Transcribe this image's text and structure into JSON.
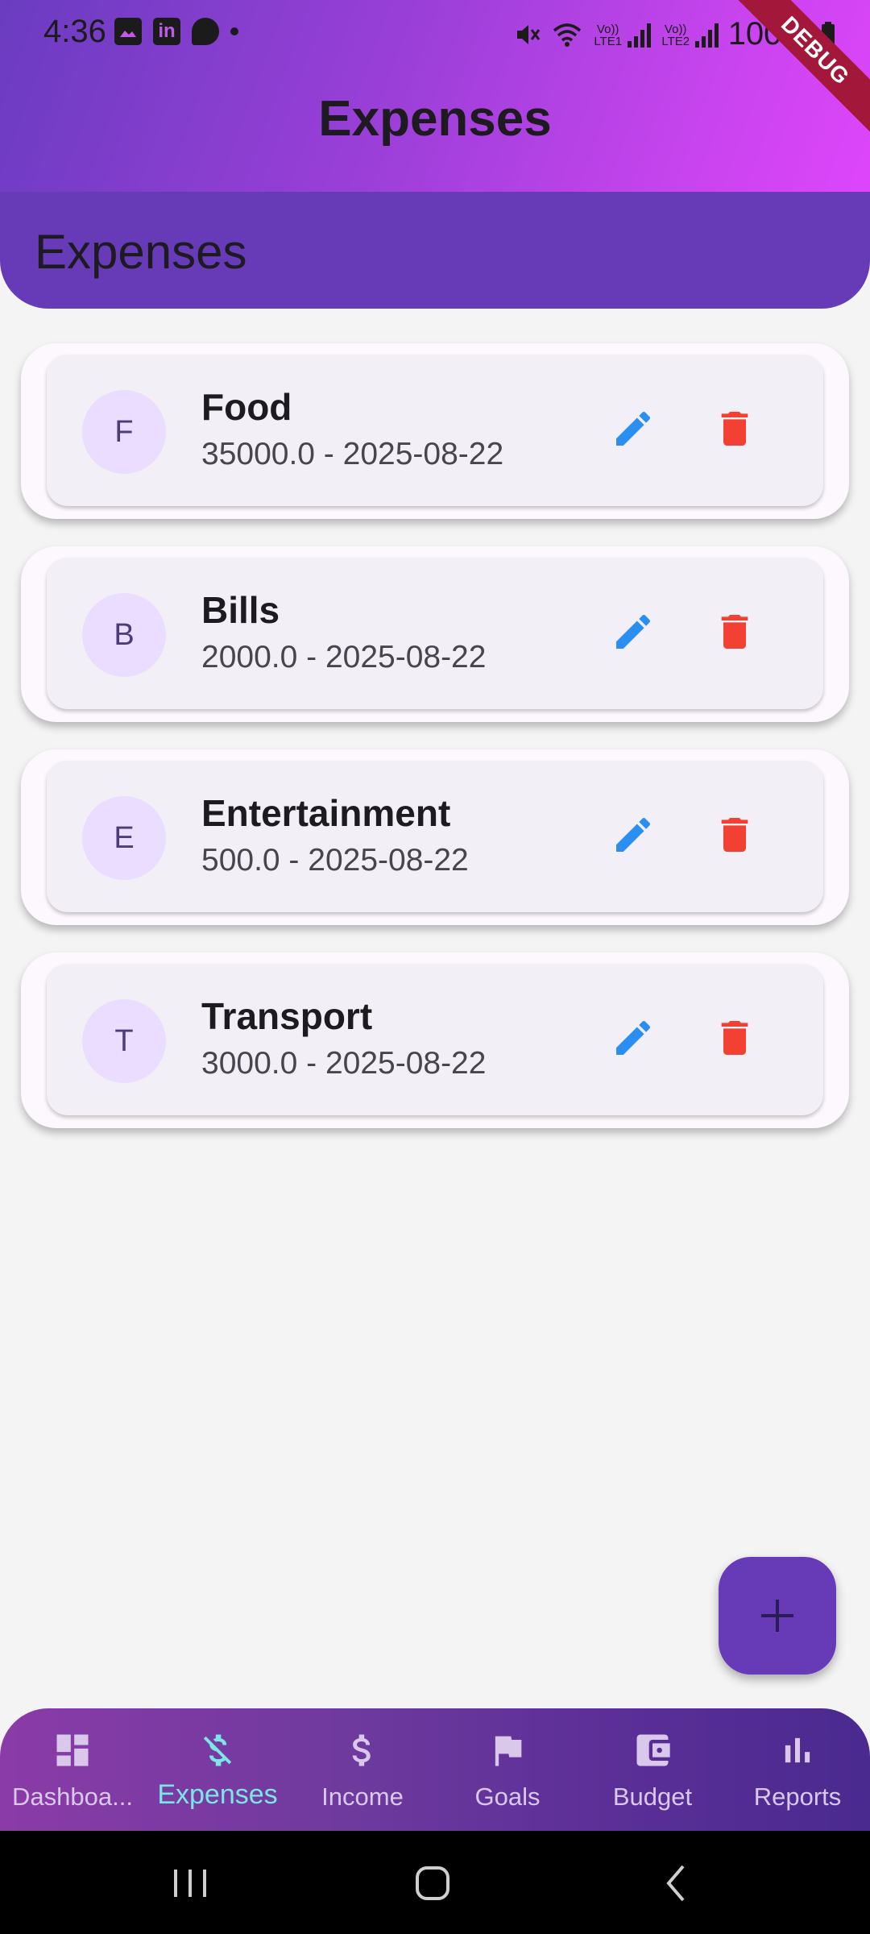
{
  "status_bar": {
    "time": "4:36",
    "left_icons": [
      "gallery-icon",
      "linkedin-icon",
      "chat-icon",
      "dot-icon"
    ],
    "right_icons": [
      "mute-icon",
      "wifi-icon",
      "lte1-signal-icon",
      "lte2-signal-icon",
      "battery-icon"
    ],
    "sim1_label": "Vo)) LTE1",
    "sim2_label": "Vo)) LTE2",
    "battery": "100%"
  },
  "debug_banner": "DEBUG",
  "app_bar": {
    "title": "Expenses"
  },
  "subheader": {
    "title": "Expenses"
  },
  "expenses": [
    {
      "initial": "F",
      "title": "Food",
      "subtitle": "35000.0 - 2025-08-22"
    },
    {
      "initial": "B",
      "title": "Bills",
      "subtitle": "2000.0 - 2025-08-22"
    },
    {
      "initial": "E",
      "title": "Entertainment",
      "subtitle": "500.0 - 2025-08-22"
    },
    {
      "initial": "T",
      "title": "Transport",
      "subtitle": "3000.0 - 2025-08-22"
    }
  ],
  "item_actions": {
    "edit_icon": "pencil-icon",
    "delete_icon": "trash-icon"
  },
  "fab": {
    "icon": "plus-icon"
  },
  "bottom_nav": {
    "items": [
      {
        "label": "Dashboa...",
        "icon": "dashboard-icon",
        "active": false
      },
      {
        "label": "Expenses",
        "icon": "money-off-icon",
        "active": true
      },
      {
        "label": "Income",
        "icon": "dollar-icon",
        "active": false
      },
      {
        "label": "Goals",
        "icon": "flag-icon",
        "active": false
      },
      {
        "label": "Budget",
        "icon": "wallet-icon",
        "active": false
      },
      {
        "label": "Reports",
        "icon": "bar-chart-icon",
        "active": false
      }
    ]
  },
  "colors": {
    "primary": "#673ab7",
    "edit": "#2a8ff0",
    "delete": "#f24133",
    "active_nav": "#7be6e6"
  }
}
